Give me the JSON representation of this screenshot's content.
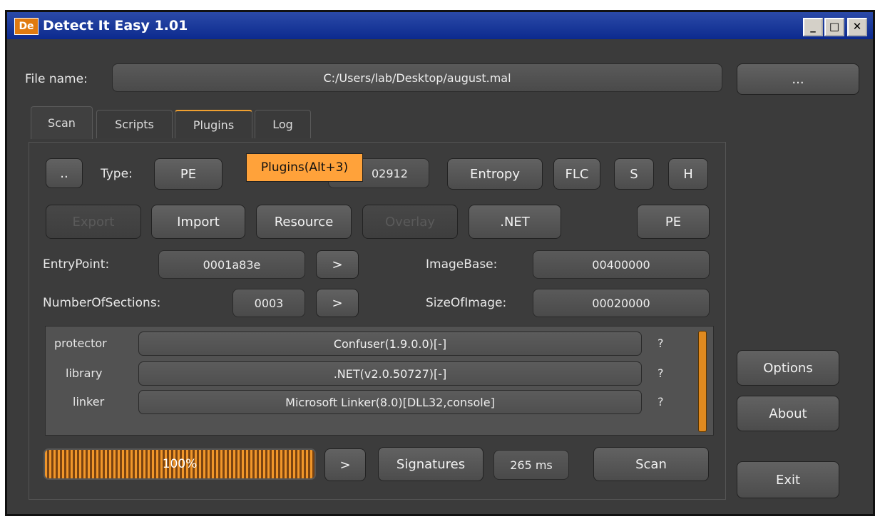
{
  "window": {
    "title": "Detect It Easy 1.01",
    "icon_text": "De",
    "min": "_",
    "max": "□",
    "close": "✕"
  },
  "file": {
    "label": "File name:",
    "path": "C:/Users/lab/Desktop/august.mal",
    "browse": "..."
  },
  "tabs": [
    {
      "label": "Scan"
    },
    {
      "label": "Scripts"
    },
    {
      "label": "Plugins"
    },
    {
      "label": "Log"
    }
  ],
  "tooltip": "Plugins(Alt+3)",
  "toolbar": {
    "up": "..",
    "type_label": "Type:",
    "type_value": "PE",
    "size_value": "02912",
    "entropy": "Entropy",
    "flc": "FLC",
    "s": "S",
    "h": "H"
  },
  "row2": {
    "export": "Export",
    "import": "Import",
    "resource": "Resource",
    "overlay": "Overlay",
    "net": ".NET",
    "pe": "PE"
  },
  "info": {
    "entrypoint_label": "EntryPoint:",
    "entrypoint_value": "0001a83e",
    "imagebase_label": "ImageBase:",
    "imagebase_value": "00400000",
    "sections_label": "NumberOfSections:",
    "sections_value": "0003",
    "sizeofimage_label": "SizeOfImage:",
    "sizeofimage_value": "00020000",
    "go": ">"
  },
  "results": [
    {
      "type": "protector",
      "value": "Confuser(1.9.0.0)[-]",
      "q": "?"
    },
    {
      "type": "library",
      "value": ".NET(v2.0.50727)[-]",
      "q": "?"
    },
    {
      "type": "linker",
      "value": "Microsoft Linker(8.0)[DLL32,console]",
      "q": "?"
    }
  ],
  "bottom": {
    "progress": "100%",
    "progress_fraction": 1.0,
    "go": ">",
    "signatures": "Signatures",
    "time": "265 ms",
    "scan": "Scan"
  },
  "side": {
    "options": "Options",
    "about": "About",
    "exit": "Exit"
  },
  "colors": {
    "accent": "#f0962a",
    "titlebar": "#0c2a8e",
    "background": "#3b3b3b"
  }
}
